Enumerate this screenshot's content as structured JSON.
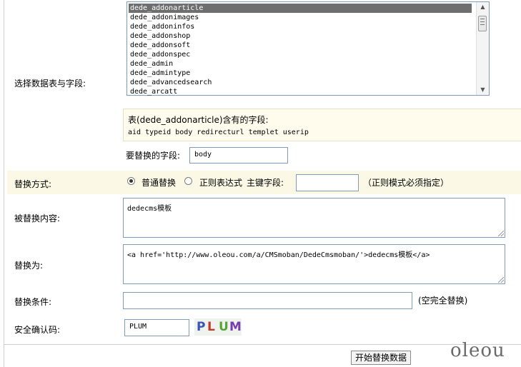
{
  "form": {
    "table_label": "选择数据表与字段:",
    "tables": [
      "dede_addonarticle",
      "dede_addonimages",
      "dede_addoninfos",
      "dede_addonshop",
      "dede_addonsoft",
      "dede_addonspec",
      "dede_admin",
      "dede_admintype",
      "dede_advancedsearch",
      "dede_arcatt"
    ],
    "selected_table": "dede_addonarticle",
    "field_info_title": "表(dede_addonarticle)含有的字段:",
    "field_info_fields": "aid typeid body redirecturl templet userip",
    "replace_field_label": "要替换的字段:",
    "replace_field_value": "body",
    "method_label": "替换方式:",
    "method_normal_label": "普通替换",
    "method_regex_label": "正则表达式",
    "primary_key_label": "主键字段:",
    "primary_key_value": "",
    "regex_note": "（正则模式必须指定）",
    "replace_content_label": "被替换内容:",
    "replace_content_value": "dedecms模板",
    "replace_with_label": "替换为:",
    "replace_with_value": "<a href='http://www.oleou.com/a/CMSmoban/DedeCmsmoban/'>dedecms模板</a>",
    "condition_label": "替换条件:",
    "condition_value": "",
    "condition_note": "(空完全替换)",
    "captcha_label": "安全确认码:",
    "captcha_value": "PLUM",
    "captcha_image_text": "PLUM",
    "submit_label": "开始替换数据",
    "watermark": "oleou"
  },
  "colors": {
    "band_bg": "#fcf8e6",
    "info_bg": "#fffcee",
    "selected_row": "#6e6e6e"
  }
}
